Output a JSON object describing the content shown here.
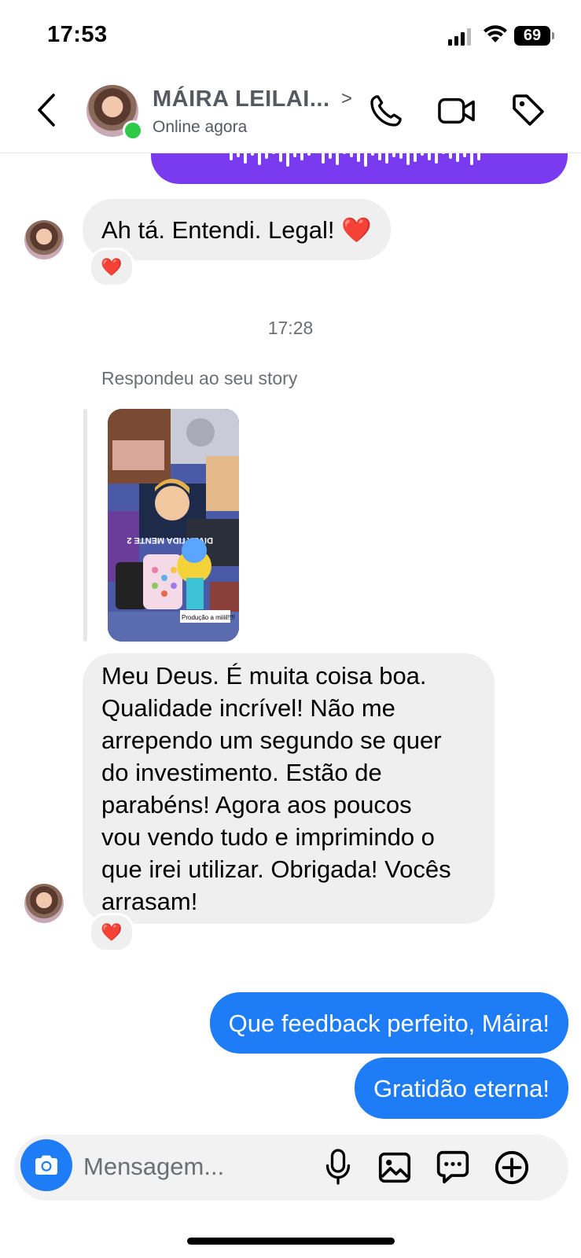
{
  "status_bar": {
    "time": "17:53",
    "battery": "69"
  },
  "header": {
    "contact_name": "MÁIRA LEILAI...",
    "chevron": ">",
    "status": "Online agora"
  },
  "chat": {
    "messages": [
      {
        "direction": "in",
        "text": "Ah tá. Entendi. Legal! ❤️",
        "reaction": "❤️"
      },
      {
        "type": "timestamp",
        "text": "17:28"
      },
      {
        "type": "story_reply_label",
        "text": "Respondeu ao seu story"
      },
      {
        "type": "story",
        "caption": "Produção a miiiil!!!!",
        "overlay_text": "DIVERTIDA MENTE 2"
      },
      {
        "direction": "in",
        "lines": [
          "Meu Deus. É muita coisa boa.",
          "Qualidade incrível! Não me",
          "arrependo um segundo se quer",
          "do investimento. Estão de",
          "parabéns! Agora aos poucos",
          "vou vendo tudo e imprimindo o",
          "que irei utilizar. Obrigada! Vocês",
          "arrasam!"
        ],
        "reaction": "❤️"
      },
      {
        "direction": "out",
        "text": "Que feedback perfeito, Máira!"
      },
      {
        "direction": "out",
        "text": "Gratidão eterna!"
      }
    ]
  },
  "composer": {
    "placeholder": "Mensagem..."
  },
  "colors": {
    "outgoing_bubble": "#1f7cf7",
    "incoming_bubble": "#efeff0",
    "audio_bubble": "#7a3bf0",
    "online_dot": "#2fc94a",
    "heart": "#e8102d"
  },
  "icons": [
    "back-chevron-icon",
    "phone-icon",
    "video-camera-icon",
    "tag-icon",
    "camera-icon",
    "microphone-icon",
    "gallery-icon",
    "sticker-chat-icon",
    "plus-circle-icon"
  ]
}
